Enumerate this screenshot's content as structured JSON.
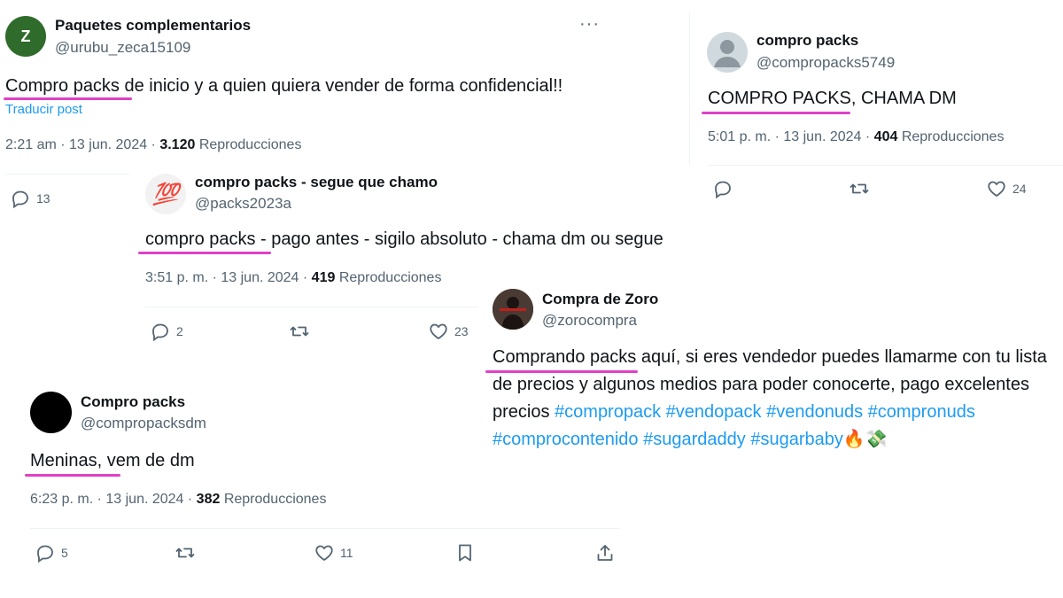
{
  "tweets": {
    "t1": {
      "name": "Paquetes complementarios",
      "handle": "@urubu_zeca15109",
      "avatar_letter": "Z",
      "avatar_color": "#2f6b2a",
      "text": "Compro packs de inicio y a quien quiera vender de forma confidencial!!",
      "translate": "Traducir post",
      "time": "2:21 am · 13 jun. 2024 · ",
      "views": "3.120",
      "views_label": " Reproducciones",
      "replies": "13",
      "more_icon": "more-dots-icon"
    },
    "t2": {
      "name": "compro packs",
      "handle": "@compropacks5749",
      "avatar_icon": "default-user-icon",
      "text": "COMPRO PACKS, CHAMA DM",
      "time": "5:01 p. m. · 13 jun. 2024 · ",
      "views": "404",
      "views_label": " Reproducciones",
      "likes": "24"
    },
    "t3": {
      "name": "compro packs - segue que chamo",
      "handle": "@packs2023a",
      "avatar_emoji": "💯",
      "text": "compro packs - pago antes - sigilo absoluto - chama dm ou segue",
      "time": "3:51 p. m. · 13 jun. 2024 · ",
      "views": "419",
      "views_label": " Reproducciones",
      "replies": "2",
      "likes": "23"
    },
    "t4": {
      "name": "Compra de Zoro",
      "handle": "@zorocompra",
      "text_plain": "Comprando packs aquí, si eres vendedor puedes llamarme con tu lista de precios y algunos medios para poder conocerte, pago excelentes precios ",
      "hashtags": [
        "#compropack",
        "#vendopack",
        "#vendonuds",
        "#compronuds",
        "#comprocontenido",
        "#sugardaddy",
        "#sugarbaby"
      ],
      "emojis": "🔥💸"
    },
    "t5": {
      "name": "Compro packs",
      "handle": "@compropacksdm",
      "avatar_color": "#000000",
      "text": "Meninas, vem de dm",
      "time": "6:23 p. m. · 13 jun. 2024 · ",
      "views": "382",
      "views_label": " Reproducciones",
      "replies": "5",
      "likes": "11"
    }
  },
  "colors": {
    "highlight": "#e040c8",
    "hashtag": "#1d9bf0",
    "secondary_text": "#536471"
  }
}
